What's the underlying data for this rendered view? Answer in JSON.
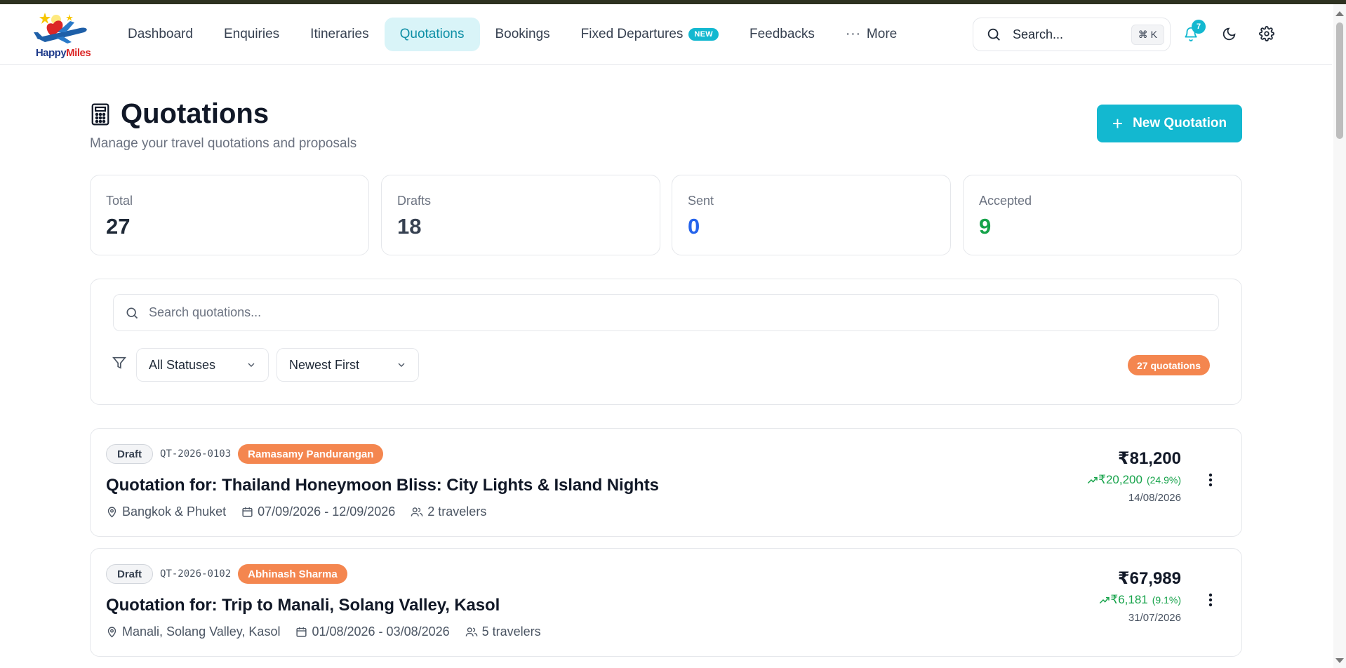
{
  "brand": {
    "name_part1": "Happy",
    "name_part2": "Miles"
  },
  "nav": {
    "items": [
      {
        "label": "Dashboard"
      },
      {
        "label": "Enquiries"
      },
      {
        "label": "Itineraries"
      },
      {
        "label": "Quotations",
        "active": true
      },
      {
        "label": "Bookings"
      },
      {
        "label": "Fixed Departures",
        "badge": "NEW"
      },
      {
        "label": "Feedbacks"
      },
      {
        "label": "More"
      }
    ]
  },
  "global_search": {
    "label": "Search...",
    "shortcut": "⌘ K"
  },
  "notifications": {
    "count": "7"
  },
  "page": {
    "title": "Quotations",
    "subtitle": "Manage your travel quotations and proposals",
    "new_button": "New Quotation"
  },
  "stats": [
    {
      "label": "Total",
      "value": "27",
      "color": "#1f2937"
    },
    {
      "label": "Drafts",
      "value": "18",
      "color": "#374151"
    },
    {
      "label": "Sent",
      "value": "0",
      "color": "#2563eb"
    },
    {
      "label": "Accepted",
      "value": "9",
      "color": "#16a34a"
    }
  ],
  "filters": {
    "search_placeholder": "Search quotations...",
    "status_select": "All Statuses",
    "sort_select": "Newest First",
    "count_label": "27 quotations"
  },
  "quotations": [
    {
      "status": "Draft",
      "id": "QT-2026-0103",
      "customer": "Ramasamy Pandurangan",
      "title": "Quotation for: Thailand Honeymoon Bliss: City Lights & Island Nights",
      "location": "Bangkok & Phuket",
      "dates": "07/09/2026 - 12/09/2026",
      "travelers": "2 travelers",
      "amount": "₹81,200",
      "margin": "₹20,200",
      "margin_pct": "(24.9%)",
      "created": "14/08/2026"
    },
    {
      "status": "Draft",
      "id": "QT-2026-0102",
      "customer": "Abhinash Sharma",
      "title": "Quotation for: Trip to Manali, Solang Valley, Kasol",
      "location": "Manali, Solang Valley, Kasol",
      "dates": "01/08/2026 - 03/08/2026",
      "travelers": "5 travelers",
      "amount": "₹67,989",
      "margin": "₹6,181",
      "margin_pct": "(9.1%)",
      "created": "31/07/2026"
    }
  ],
  "colors": {
    "accent": "#13b8d0",
    "active_nav_bg": "#d9f4f8",
    "customer_pill": "#f4864f",
    "margin_green": "#16a34a"
  }
}
